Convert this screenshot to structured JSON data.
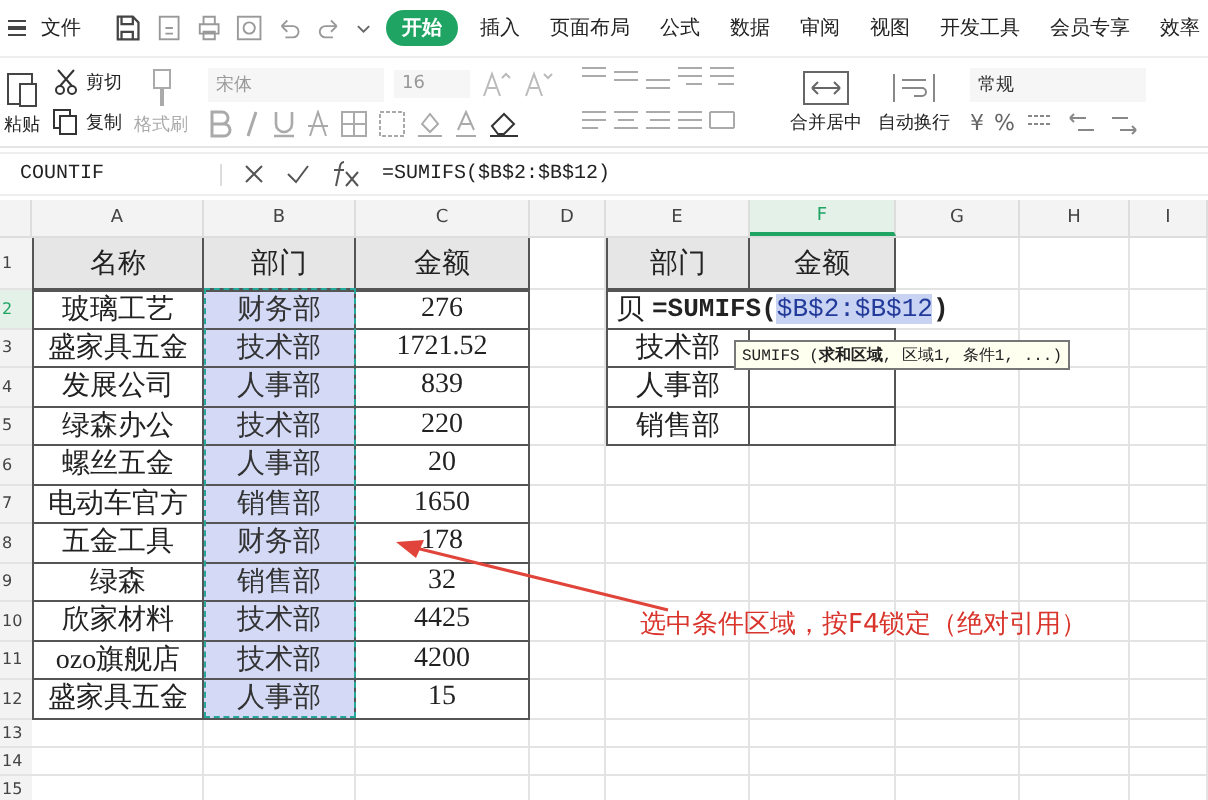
{
  "menu_bar": {
    "file_label": "文件",
    "tabs": [
      {
        "label": "开始",
        "selected": true
      },
      {
        "label": "插入",
        "selected": false
      },
      {
        "label": "页面布局",
        "selected": false
      },
      {
        "label": "公式",
        "selected": false
      },
      {
        "label": "数据",
        "selected": false
      },
      {
        "label": "审阅",
        "selected": false
      },
      {
        "label": "视图",
        "selected": false
      },
      {
        "label": "开发工具",
        "selected": false
      },
      {
        "label": "会员专享",
        "selected": false
      },
      {
        "label": "效率",
        "selected": false
      }
    ]
  },
  "ribbon": {
    "paste": "粘贴",
    "cut": "剪切",
    "copy": "复制",
    "format_painter": "格式刷",
    "font_name": "宋体",
    "font_size": "16",
    "merge": "合并居中",
    "wrap": "自动换行",
    "number_format": "常规",
    "currency": "¥",
    "percent": "%"
  },
  "formula_bar": {
    "name_box": "COUNTIF",
    "formula": "=SUMIFS($B$2:$B$12)"
  },
  "sheet": {
    "columns": [
      {
        "label": "A",
        "selected": false
      },
      {
        "label": "B",
        "selected": false
      },
      {
        "label": "C",
        "selected": false
      },
      {
        "label": "D",
        "selected": false
      },
      {
        "label": "E",
        "selected": false
      },
      {
        "label": "F",
        "selected": true
      },
      {
        "label": "G",
        "selected": false
      },
      {
        "label": "H",
        "selected": false
      },
      {
        "label": "I",
        "selected": false
      }
    ],
    "row_numbers": [
      {
        "label": "1",
        "selected": false
      },
      {
        "label": "2",
        "selected": true
      },
      {
        "label": "3",
        "selected": false
      },
      {
        "label": "4",
        "selected": false
      },
      {
        "label": "5",
        "selected": false
      },
      {
        "label": "6",
        "selected": false
      },
      {
        "label": "7",
        "selected": false
      },
      {
        "label": "8",
        "selected": false
      },
      {
        "label": "9",
        "selected": false
      },
      {
        "label": "10",
        "selected": false
      },
      {
        "label": "11",
        "selected": false
      },
      {
        "label": "12",
        "selected": false
      },
      {
        "label": "13",
        "selected": false
      },
      {
        "label": "14",
        "selected": false
      },
      {
        "label": "15",
        "selected": false
      }
    ],
    "table1": {
      "headers": [
        {
          "label": "名称",
          "highlighted": false
        },
        {
          "label": "部门",
          "highlighted": true
        },
        {
          "label": "金额",
          "highlighted": false
        }
      ],
      "rows": [
        [
          "玻璃工艺",
          "财务部",
          "276"
        ],
        [
          "盛家具五金",
          "技术部",
          "1721.52"
        ],
        [
          "发展公司",
          "人事部",
          "839"
        ],
        [
          "绿森办公",
          "技术部",
          "220"
        ],
        [
          "螺丝五金",
          "人事部",
          "20"
        ],
        [
          "电动车官方",
          "销售部",
          "1650"
        ],
        [
          "五金工具",
          "财务部",
          "178"
        ],
        [
          "绿森",
          "销售部",
          "32"
        ],
        [
          "欣家材料",
          "技术部",
          "4425"
        ],
        [
          "ozo旗舰店",
          "技术部",
          "4200"
        ],
        [
          "盛家具五金",
          "人事部",
          "15"
        ]
      ]
    },
    "table2": {
      "headers": [
        "部门",
        "金额"
      ],
      "rows": [
        "贝",
        "技术部",
        "人事部",
        "销售部"
      ]
    },
    "editor": {
      "start": "=SUMIFS(",
      "reference": "$B$2:$B$12",
      "end": ")"
    },
    "tooltip": "SUMIFS (**求和区域**, 区域1, 条件1, ...)",
    "annotation": "选中条件区域，按F4锁定（绝对引用）"
  }
}
